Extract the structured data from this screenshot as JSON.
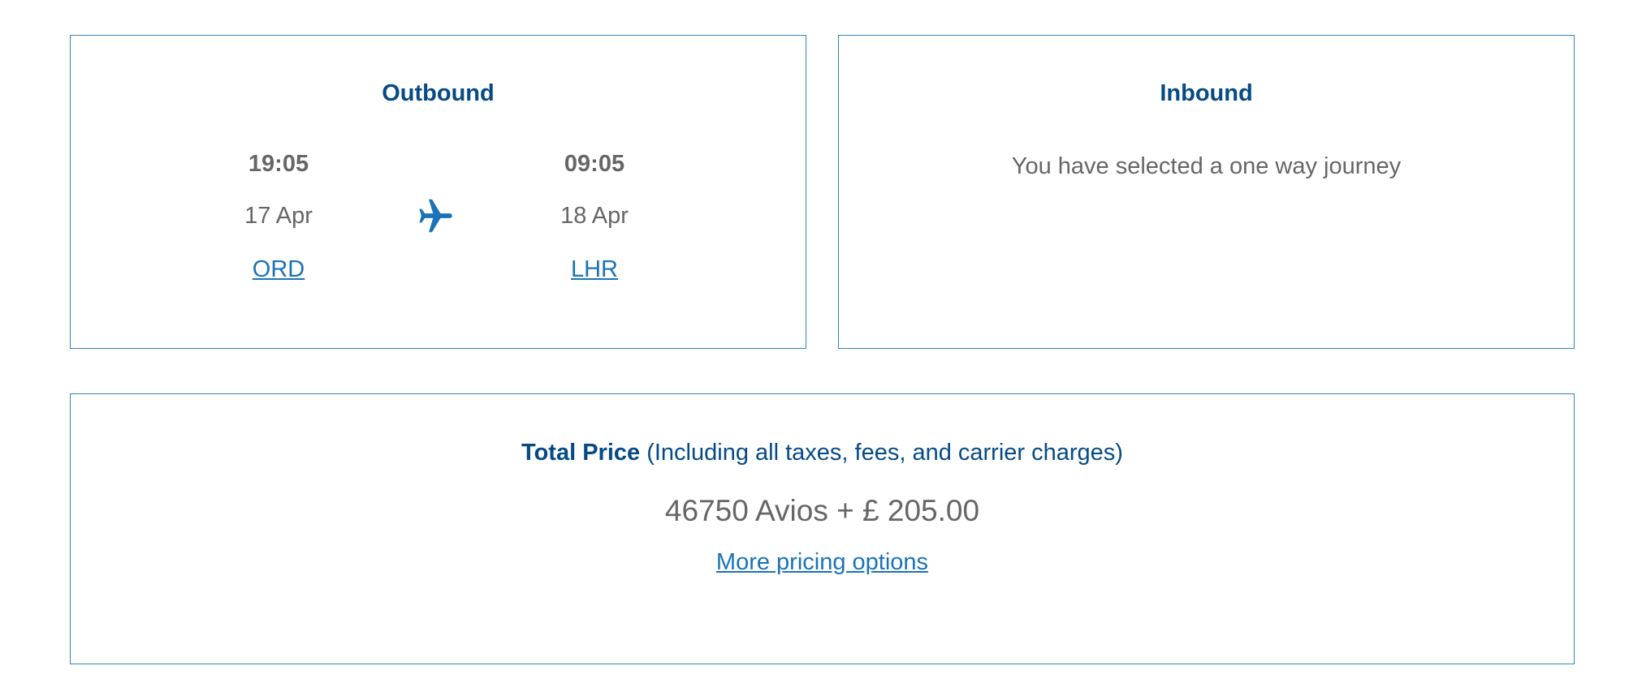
{
  "outbound": {
    "title": "Outbound",
    "departure": {
      "time": "19:05",
      "date": "17 Apr",
      "airport": "ORD"
    },
    "arrival": {
      "time": "09:05",
      "date": "18 Apr",
      "airport": "LHR"
    },
    "icon": "plane-icon"
  },
  "inbound": {
    "title": "Inbound",
    "message": "You have selected a one way journey"
  },
  "price": {
    "label": "Total Price",
    "note": "(Including all taxes, fees, and carrier charges)",
    "amount": "46750 Avios + £ 205.00",
    "more_link": "More pricing options"
  },
  "colors": {
    "heading": "#064a85",
    "link": "#1a73b8",
    "border": "#2e86b8",
    "text": "#666666"
  }
}
